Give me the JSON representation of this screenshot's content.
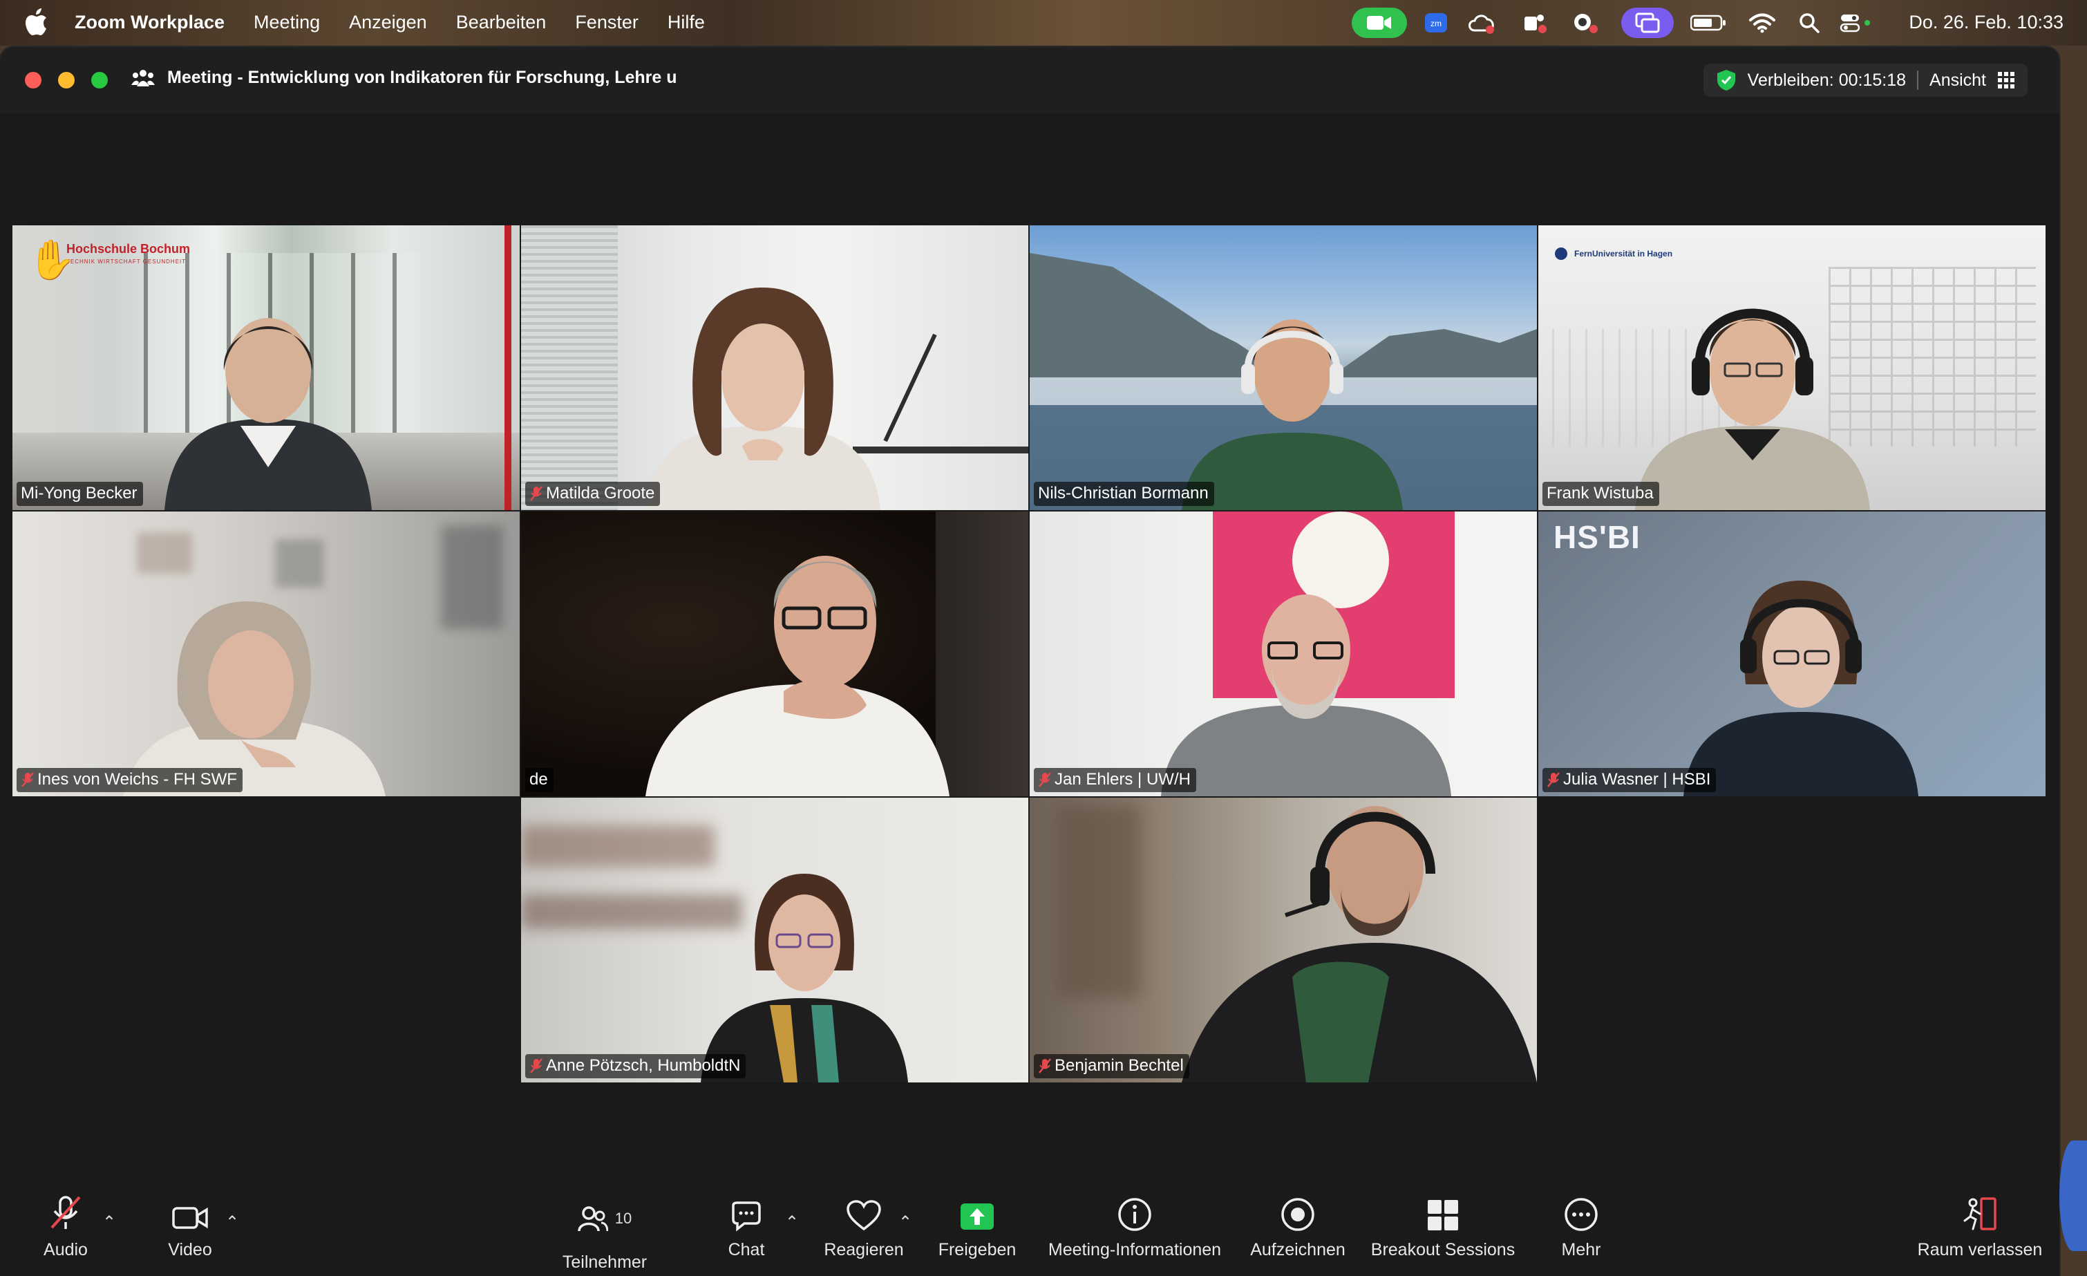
{
  "menubar": {
    "app_name": "Zoom Workplace",
    "items": [
      "Meeting",
      "Anzeigen",
      "Bearbeiten",
      "Fenster",
      "Hilfe"
    ],
    "clock": "Do. 26. Feb.  10:33"
  },
  "titlebar": {
    "meeting_title": "Meeting - Entwicklung von Indikatoren für Forschung, Lehre u",
    "remaining": "Verbleiben: 00:15:18",
    "view_label": "Ansicht"
  },
  "tiles": [
    {
      "name": "Mi-Yong Becker",
      "muted": false,
      "background_text": "Hochschule Bochum",
      "background_subtext": "TECHNIK WIRTSCHAFT GESUNDHEIT"
    },
    {
      "name": "Matilda Groote",
      "muted": true
    },
    {
      "name": "Nils-Christian Bormann",
      "muted": false,
      "active_speaker": true
    },
    {
      "name": "Frank Wistuba",
      "muted": false,
      "background_text": "FernUniversität in Hagen"
    },
    {
      "name": "Ines von Weichs - FH SWF",
      "muted": true
    },
    {
      "name": "de",
      "muted": false
    },
    {
      "name": "Jan Ehlers | UW/H",
      "muted": true
    },
    {
      "name": "Julia Wasner | HSBI",
      "muted": true,
      "background_text": "HS'BI"
    },
    {
      "name": "Anne Pötzsch, HumboldtN",
      "muted": true
    },
    {
      "name": "Benjamin Bechtel",
      "muted": true
    }
  ],
  "toolbar": {
    "audio": "Audio",
    "video": "Video",
    "participants": "Teilnehmer",
    "participants_count": "10",
    "chat": "Chat",
    "react": "Reagieren",
    "share": "Freigeben",
    "meeting_info": "Meeting-Informationen",
    "record": "Aufzeichnen",
    "breakout": "Breakout Sessions",
    "more": "Mehr",
    "leave": "Raum verlassen"
  },
  "colors": {
    "active_speaker_border": "#4fc84f",
    "share_green": "#23c552",
    "leave_red": "#e5484d",
    "muted_red": "#e5484d"
  }
}
